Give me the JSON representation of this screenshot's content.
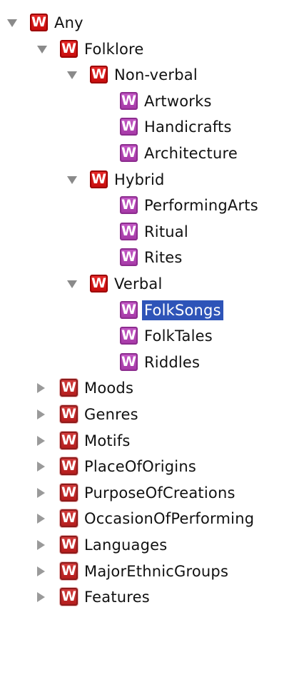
{
  "tree": {
    "selected": "FolkSongs",
    "nodes": [
      {
        "key": "any",
        "label": "Any",
        "level": 0,
        "toggle": "expanded",
        "icon": "red",
        "row": 0
      },
      {
        "key": "folklore",
        "label": "Folklore",
        "level": 1,
        "toggle": "expanded",
        "icon": "red",
        "row": 1
      },
      {
        "key": "non-verbal",
        "label": "Non-verbal",
        "level": 2,
        "toggle": "expanded",
        "icon": "red",
        "row": 2
      },
      {
        "key": "artworks",
        "label": "Artworks",
        "level": 3,
        "toggle": "none",
        "icon": "purple",
        "row": 3
      },
      {
        "key": "handicrafts",
        "label": "Handicrafts",
        "level": 3,
        "toggle": "none",
        "icon": "purple",
        "row": 4
      },
      {
        "key": "architecture",
        "label": "Architecture",
        "level": 3,
        "toggle": "none",
        "icon": "purple",
        "row": 5
      },
      {
        "key": "hybrid",
        "label": "Hybrid",
        "level": 2,
        "toggle": "expanded",
        "icon": "red",
        "row": 6
      },
      {
        "key": "performingarts",
        "label": "PerformingArts",
        "level": 3,
        "toggle": "none",
        "icon": "purple",
        "row": 7
      },
      {
        "key": "ritual",
        "label": "Ritual",
        "level": 3,
        "toggle": "none",
        "icon": "purple",
        "row": 8
      },
      {
        "key": "rites",
        "label": "Rites",
        "level": 3,
        "toggle": "none",
        "icon": "purple",
        "row": 9
      },
      {
        "key": "verbal",
        "label": "Verbal",
        "level": 2,
        "toggle": "expanded",
        "icon": "red",
        "row": 10
      },
      {
        "key": "folksongs",
        "label": "FolkSongs",
        "level": 3,
        "toggle": "none",
        "icon": "purple",
        "row": 11,
        "selected": true
      },
      {
        "key": "folktales",
        "label": "FolkTales",
        "level": 3,
        "toggle": "none",
        "icon": "purple",
        "row": 12
      },
      {
        "key": "riddles",
        "label": "Riddles",
        "level": 3,
        "toggle": "none",
        "icon": "purple",
        "row": 13
      },
      {
        "key": "moods",
        "label": "Moods",
        "level": 1,
        "toggle": "collapsed",
        "icon": "red-dim",
        "row": 14
      },
      {
        "key": "genres",
        "label": "Genres",
        "level": 1,
        "toggle": "collapsed",
        "icon": "red-dim",
        "row": 15
      },
      {
        "key": "motifs",
        "label": "Motifs",
        "level": 1,
        "toggle": "collapsed",
        "icon": "red-dim",
        "row": 16
      },
      {
        "key": "placeoforigins",
        "label": "PlaceOfOrigins",
        "level": 1,
        "toggle": "collapsed",
        "icon": "red-dim",
        "row": 17
      },
      {
        "key": "purposeofcreations",
        "label": "PurposeOfCreations",
        "level": 1,
        "toggle": "collapsed",
        "icon": "red-dim",
        "row": 18
      },
      {
        "key": "occasionofperforming",
        "label": "OccasionOfPerforming",
        "level": 1,
        "toggle": "collapsed",
        "icon": "red-dim",
        "row": 19
      },
      {
        "key": "languages",
        "label": "Languages",
        "level": 1,
        "toggle": "collapsed",
        "icon": "red-dim",
        "row": 20
      },
      {
        "key": "majorethnicgroups",
        "label": "MajorEthnicGroups",
        "level": 1,
        "toggle": "collapsed",
        "icon": "red-dim",
        "row": 21
      },
      {
        "key": "features",
        "label": "Features",
        "level": 1,
        "toggle": "collapsed",
        "icon": "red-dim",
        "row": 22
      }
    ]
  },
  "icon_glyph": "W",
  "icon_name": "class-w-icon",
  "colors": {
    "selection": "#2e54b8",
    "class_icon_red": "#d41616",
    "class_icon_purple": "#b347b5",
    "toggle_gray": "#8a8a8a"
  }
}
